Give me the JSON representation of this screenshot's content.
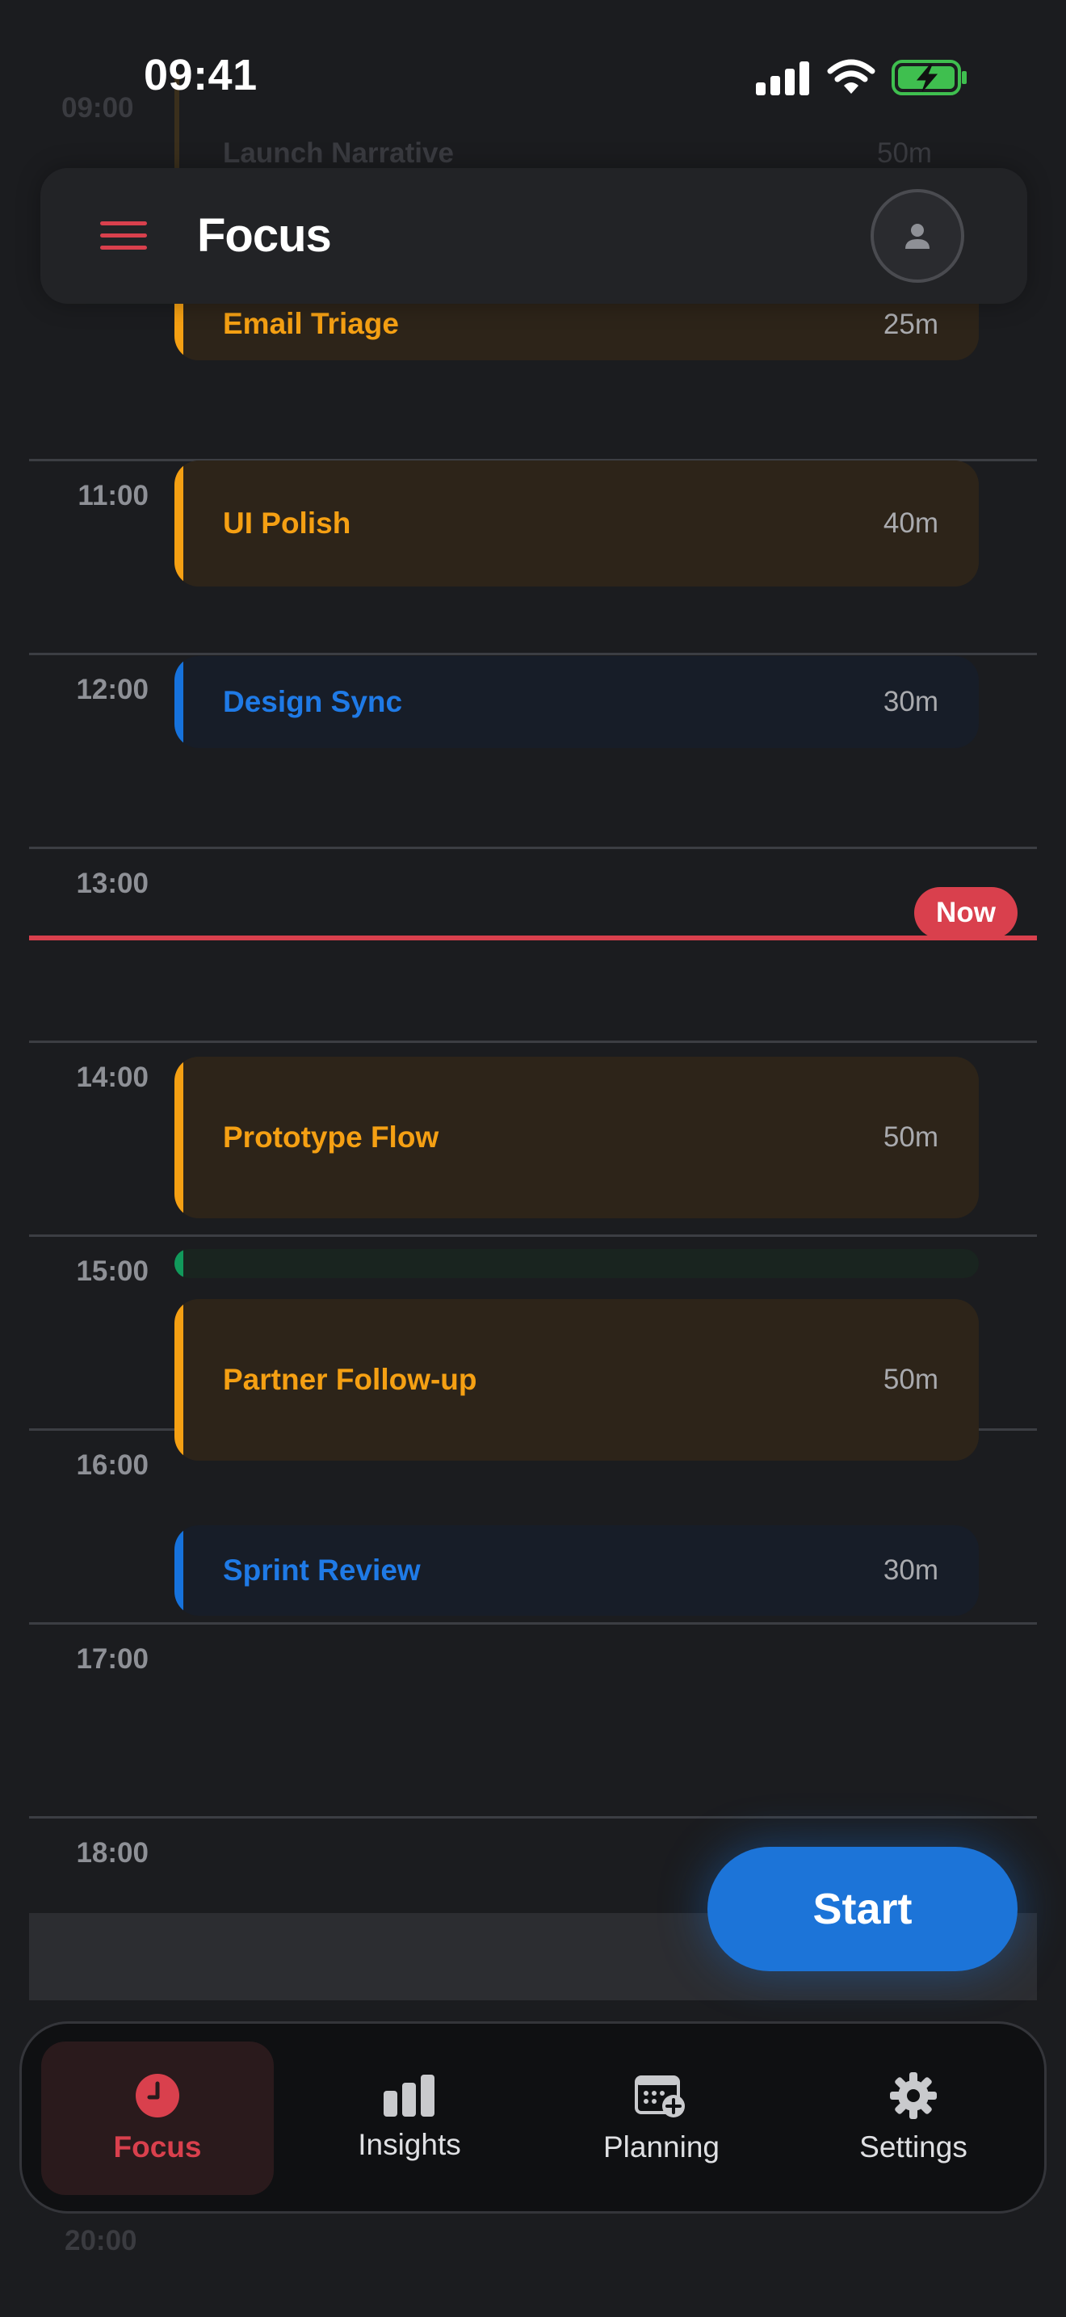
{
  "status_bar": {
    "time": "09:41"
  },
  "header": {
    "title": "Focus"
  },
  "timeline": {
    "hours": [
      "09:00",
      "11:00",
      "12:00",
      "13:00",
      "14:00",
      "15:00",
      "16:00",
      "17:00",
      "18:00",
      "20:00"
    ],
    "events": [
      {
        "title": "Launch Narrative",
        "duration": "50m",
        "color": "orange"
      },
      {
        "title": "Email Triage",
        "duration": "25m",
        "color": "orange"
      },
      {
        "title": "UI Polish",
        "duration": "40m",
        "color": "orange"
      },
      {
        "title": "Design Sync",
        "duration": "30m",
        "color": "blue"
      },
      {
        "title": "Prototype Flow",
        "duration": "50m",
        "color": "orange"
      },
      {
        "title": "Partner Follow-up",
        "duration": "50m",
        "color": "orange"
      },
      {
        "title": "Sprint Review",
        "duration": "30m",
        "color": "blue"
      }
    ],
    "now_label": "Now"
  },
  "start_button": {
    "label": "Start"
  },
  "tabs": [
    {
      "label": "Focus",
      "icon": "clock-icon",
      "active": true
    },
    {
      "label": "Insights",
      "icon": "bar-chart-icon",
      "active": false
    },
    {
      "label": "Planning",
      "icon": "calendar-add-icon",
      "active": false
    },
    {
      "label": "Settings",
      "icon": "gear-icon",
      "active": false
    }
  ],
  "colors": {
    "accent_red": "#d9404d",
    "orange": "#f5a013",
    "blue": "#1f7ae6",
    "green": "#11995b",
    "background": "#1b1c1f"
  }
}
